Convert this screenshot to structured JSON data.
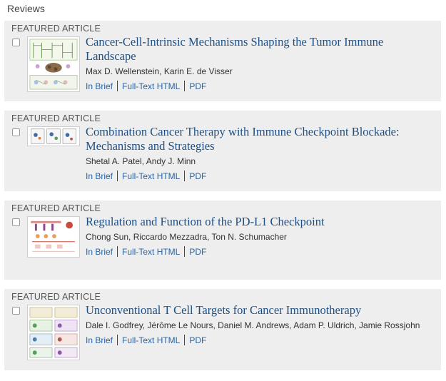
{
  "section": {
    "title": "Reviews"
  },
  "articles": [
    {
      "label": "FEATURED ARTICLE",
      "title": "Cancer-Cell-Intrinsic Mechanisms Shaping the Tumor Immune Landscape",
      "authors": "Max D. Wellenstein, Karin E. de Visser",
      "links": {
        "brief": "In Brief",
        "html": "Full-Text HTML",
        "pdf": "PDF"
      }
    },
    {
      "label": "FEATURED ARTICLE",
      "title": "Combination Cancer Therapy with Immune Checkpoint Blockade: Mechanisms and Strategies",
      "authors": "Shetal A. Patel, Andy J. Minn",
      "links": {
        "brief": "In Brief",
        "html": "Full-Text HTML",
        "pdf": "PDF"
      }
    },
    {
      "label": "FEATURED ARTICLE",
      "title": "Regulation and Function of the PD-L1 Checkpoint",
      "authors": "Chong Sun, Riccardo Mezzadra, Ton N. Schumacher",
      "links": {
        "brief": "In Brief",
        "html": "Full-Text HTML",
        "pdf": "PDF"
      }
    },
    {
      "label": "FEATURED ARTICLE",
      "title": "Unconventional T Cell Targets for Cancer Immunotherapy",
      "authors": "Dale I. Godfrey, Jérôme Le Nours, Daniel M. Andrews, Adam P. Uldrich, Jamie Rossjohn",
      "links": {
        "brief": "In Brief",
        "html": "Full-Text HTML",
        "pdf": "PDF"
      }
    }
  ]
}
